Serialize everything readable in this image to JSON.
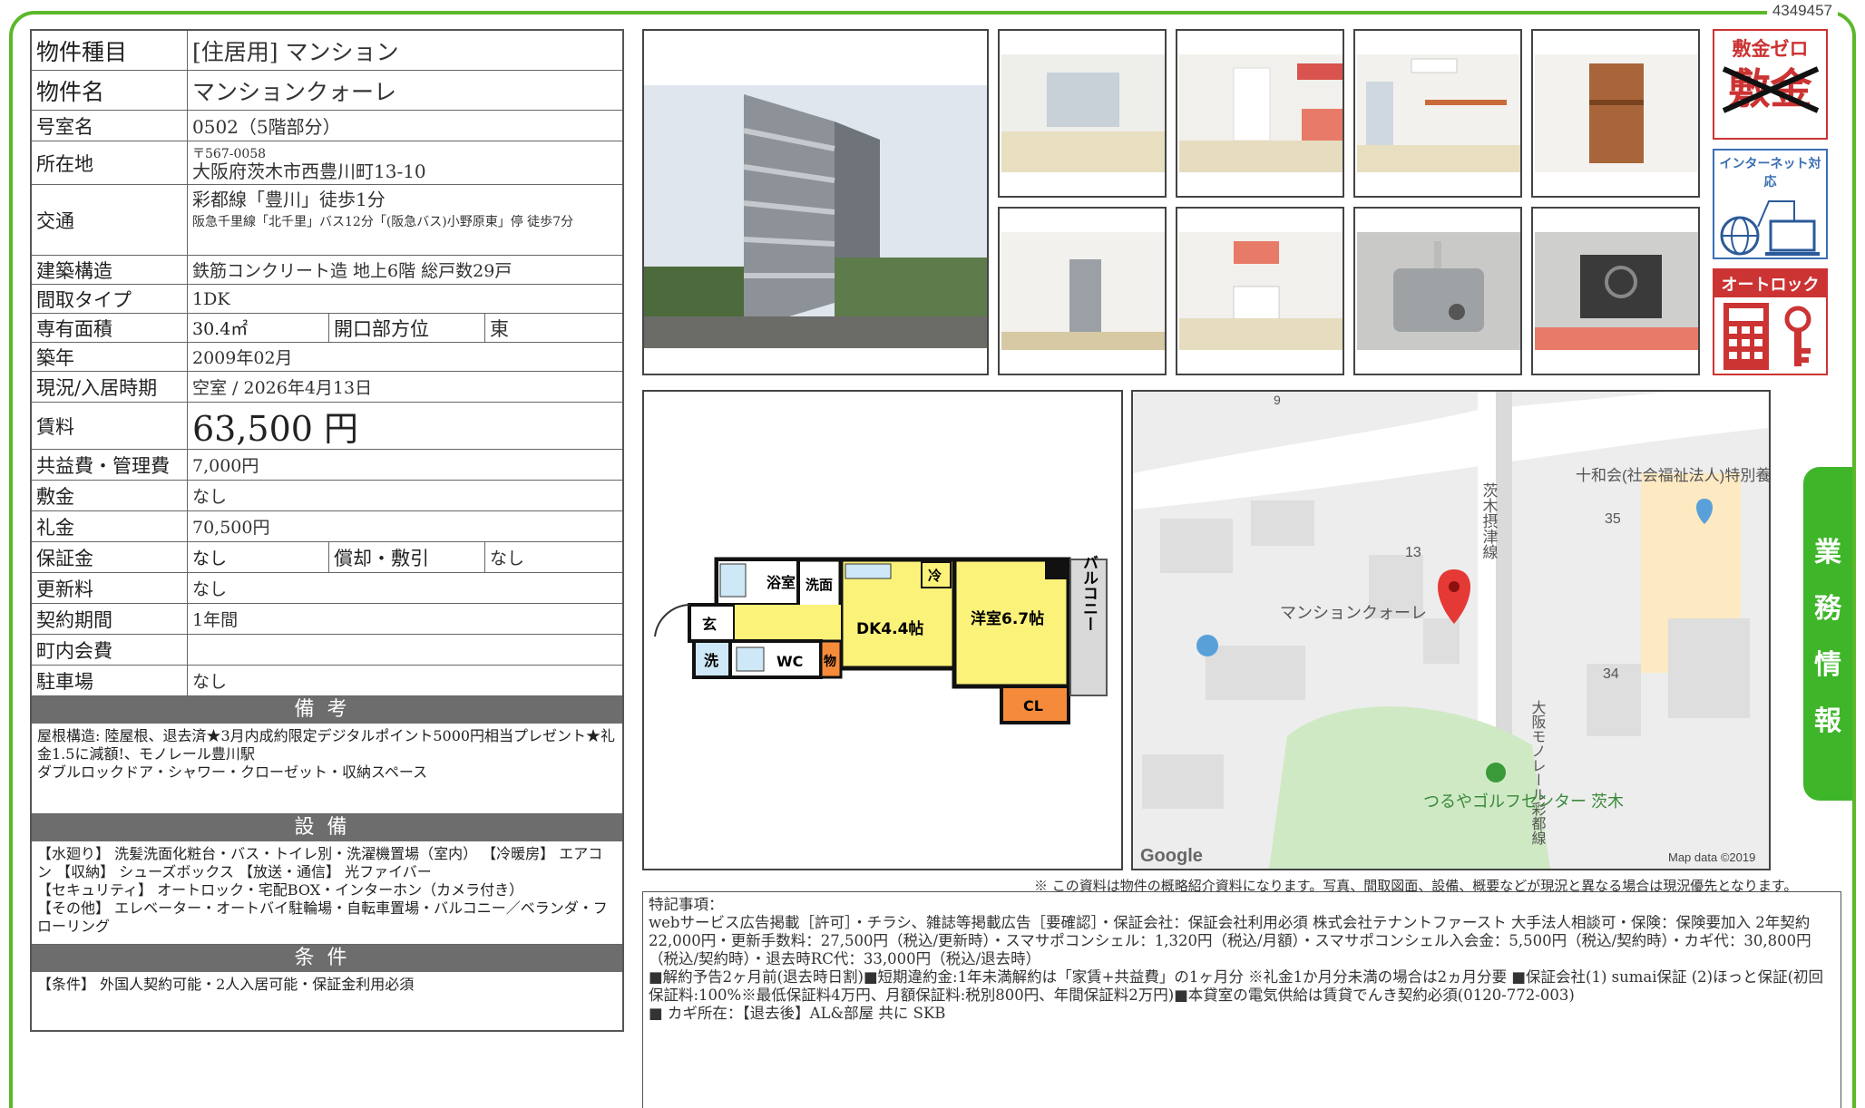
{
  "doc_id": "4349457",
  "side_tab": [
    "業",
    "務",
    "情",
    "報"
  ],
  "rows": {
    "type": {
      "label": "物件種目",
      "value": "[住居用]  マンション"
    },
    "name": {
      "label": "物件名",
      "value": "マンションクォーレ"
    },
    "room": {
      "label": "号室名",
      "value": "0502（5階部分）"
    },
    "address": {
      "label": "所在地",
      "zip": "〒567-0058",
      "value": "大阪府茨木市西豊川町13-10"
    },
    "access": {
      "label": "交通",
      "line1": "彩都線「豊川」徒歩1分",
      "line2": "阪急千里線「北千里」バス12分「(阪急バス)小野原東」停  徒歩7分"
    },
    "structure": {
      "label": "建築構造",
      "value": "鉄筋コンクリート造  地上6階  総戸数29戸"
    },
    "layout": {
      "label": "間取タイプ",
      "value": "1DK"
    },
    "area": {
      "label": "専有面積",
      "value": "30.4㎡",
      "sub_label": "開口部方位",
      "sub_value": "東"
    },
    "built": {
      "label": "築年",
      "value": "2009年02月"
    },
    "status": {
      "label": "現況/入居時期",
      "value": "空室  /  2026年4月13日"
    },
    "rent": {
      "label": "賃料",
      "value": "63,500 円"
    },
    "fee": {
      "label": "共益費・管理費",
      "value": "7,000円"
    },
    "deposit": {
      "label": "敷金",
      "value": "なし"
    },
    "key_money": {
      "label": "礼金",
      "value": "70,500円"
    },
    "guarantee": {
      "label": "保証金",
      "value": "なし",
      "sub_label": "償却・敷引",
      "sub_value": "なし"
    },
    "renewal": {
      "label": "更新料",
      "value": "なし"
    },
    "contract": {
      "label": "契約期間",
      "value": "1年間"
    },
    "community": {
      "label": "町内会費",
      "value": ""
    },
    "parking": {
      "label": "駐車場",
      "value": "なし"
    }
  },
  "sections": {
    "remarks_title": "備考",
    "remarks_text": "屋根構造:  陸屋根、退去済★3月内成約限定デジタルポイント5000円相当プレゼント★礼金1.5に減額!、モノレール豊川駅\nダブルロックドア・シャワー・クローゼット・収納スペース",
    "equip_title": "設備",
    "equip_text": "【水廻り】 洗髪洗面化粧台・バス・トイレ別・洗濯機置場（室内）  【冷暖房】 エアコン 【収納】 シューズボックス 【放送・通信】 光ファイバー\n【セキュリティ】 オートロック・宅配BOX・インターホン（カメラ付き）\n【その他】 エレベーター・オートバイ駐輪場・自転車置場・バルコニー／ベランダ・フローリング",
    "cond_title": "条件",
    "cond_text": "【条件】 外国人契約可能・2人入居可能・保証金利用必須"
  },
  "badges": {
    "zero_deposit": "敷金ゼロ",
    "zero_deposit_crossed": "敷金",
    "internet": "インターネット対応",
    "autolock": "オートロック"
  },
  "floorplan": {
    "bath": "浴室",
    "wash": "洗面",
    "fridge": "冷",
    "entrance": "玄",
    "laundry": "洗",
    "wc": "WC",
    "storage": "物",
    "dk": "DK4.4帖",
    "western": "洋室6.7帖",
    "closet": "CL",
    "balcony": "バルコニー"
  },
  "map": {
    "label_9": "9",
    "label_13": "13",
    "label_35": "35",
    "label_34": "34",
    "building": "マンションクォーレ",
    "facility": "十和会(社会福祉法人)特別養護老人…",
    "road1": "茨木摂津線",
    "road2": "大阪モノレール彩都線",
    "golf": "つるやゴルフセンター 茨木",
    "google": "Google",
    "mapdata": "Map data ©2019"
  },
  "disclaimer": "※ この資料は物件の概略紹介資料になります。写真、間取図面、設備、概要などが現況と異なる場合は現況優先となります。",
  "special": {
    "title": "特記事項：",
    "text": "webサービス広告掲載［許可］・チラシ、雑誌等掲載広告［要確認］・保証会社：保証会社利用必須 株式会社テナントファースト  大手法人相談可・保険：保険要加入 2年契約 22,000円・更新手数料：27,500円（税込/更新時）・スマサポコンシェル：1,320円（税込/月額）・スマサポコンシェル入会金：5,500円（税込/契約時）・カギ代：30,800円（税込/契約時）・退去時RC代：33,000円（税込/退去時）\n■解約予告2ヶ月前(退去時日割)■短期違約金:1年未満解約は「家賃+共益費」の1ヶ月分  ※礼金1か月分未満の場合は2ヵ月分要  ■保証会社(1) sumai保証  (2)ほっと保証(初回保証料:100%※最低保証料4万円、月額保証料:税別800円、年間保証料2万円)■本貸室の電気供給は賃貸でんき契約必須(0120-772-003)\n■ カギ所在：【退去後】AL&部屋  共に  SKB"
  }
}
